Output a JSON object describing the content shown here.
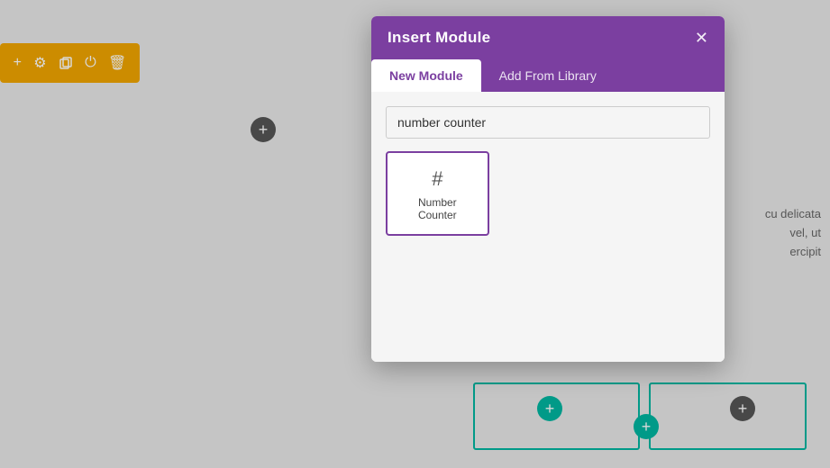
{
  "toolbar": {
    "icons": [
      "plus-icon",
      "gear-icon",
      "clone-icon",
      "power-icon",
      "trash-icon"
    ]
  },
  "page": {
    "add_button_label": "+",
    "text_line1": "cu delicata",
    "text_line2": "vel, ut",
    "text_line3": "ercipit"
  },
  "modal": {
    "title": "Insert Module",
    "close_label": "✕",
    "tabs": [
      {
        "label": "New Module",
        "active": true
      },
      {
        "label": "Add From Library",
        "active": false
      }
    ],
    "search_placeholder": "number counter",
    "search_value": "number counter",
    "modules": [
      {
        "icon": "#",
        "label": "Number Counter"
      }
    ]
  },
  "bottom": {
    "add_label": "+"
  }
}
